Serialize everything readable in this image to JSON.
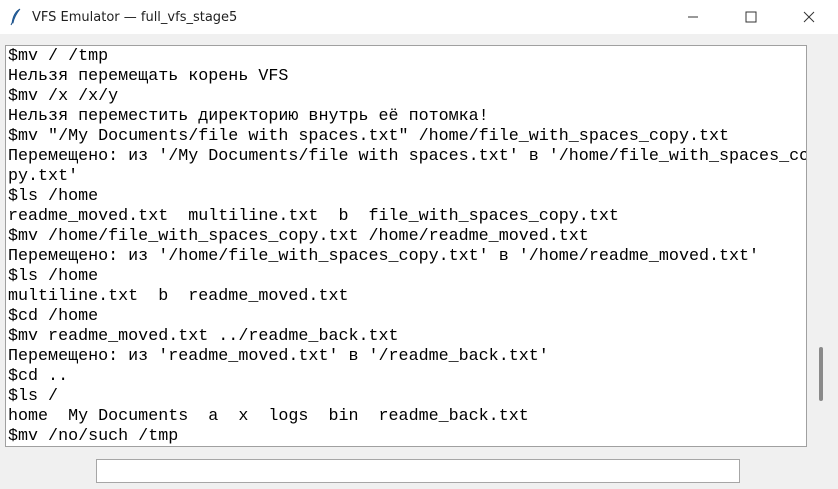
{
  "window": {
    "title": "VFS Emulator — full_vfs_stage5",
    "controls": [
      "minimize-icon",
      "maximize-icon",
      "close-icon"
    ]
  },
  "terminal": {
    "lines": [
      "$mv / /tmp",
      "Нельзя перемещать корень VFS",
      "$mv /x /x/y",
      "Нельзя переместить директорию внутрь её потомка!",
      "$mv \"/My Documents/file with spaces.txt\" /home/file_with_spaces_copy.txt",
      "Перемещено: из '/My Documents/file with spaces.txt' в '/home/file_with_spaces_co",
      "py.txt'",
      "$ls /home",
      "readme_moved.txt  multiline.txt  b  file_with_spaces_copy.txt",
      "$mv /home/file_with_spaces_copy.txt /home/readme_moved.txt",
      "Перемещено: из '/home/file_with_spaces_copy.txt' в '/home/readme_moved.txt'",
      "$ls /home",
      "multiline.txt  b  readme_moved.txt",
      "$cd /home",
      "$mv readme_moved.txt ../readme_back.txt",
      "Перемещено: из 'readme_moved.txt' в '/readme_back.txt'",
      "$cd ..",
      "$ls /",
      "home  My Documents  a  x  logs  bin  readme_back.txt",
      "$mv /no/such /tmp"
    ]
  },
  "input": {
    "value": ""
  }
}
